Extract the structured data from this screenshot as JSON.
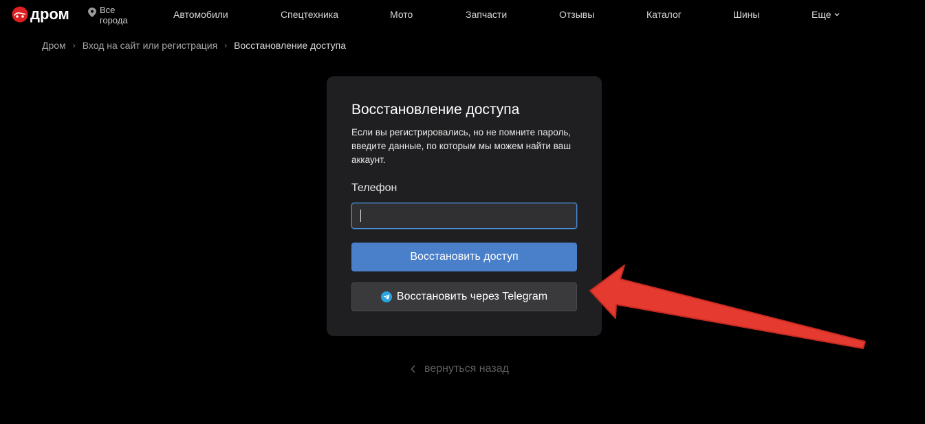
{
  "header": {
    "logo_text": "дром",
    "city": "Все города",
    "nav": [
      {
        "label": "Автомобили"
      },
      {
        "label": "Спецтехника"
      },
      {
        "label": "Мото"
      },
      {
        "label": "Запчасти"
      },
      {
        "label": "Отзывы"
      },
      {
        "label": "Каталог"
      },
      {
        "label": "Шины"
      }
    ],
    "more_label": "Еще"
  },
  "breadcrumb": {
    "items": [
      "Дром",
      "Вход на сайт или регистрация"
    ],
    "current": "Восстановление доступа",
    "separator": "›"
  },
  "card": {
    "title": "Восстановление доступа",
    "description": "Если вы регистрировались, но не помните пароль, введите данные, по которым мы можем найти ваш аккаунт.",
    "phone_label": "Телефон",
    "phone_value": "",
    "primary_button": "Восстановить доступ",
    "telegram_button": "Восстановить через Telegram"
  },
  "back_link": "вернуться назад",
  "colors": {
    "brand_red": "#e02020",
    "primary_blue": "#4a7fca",
    "telegram_blue": "#2aa3e0",
    "annotation_arrow": "#e53a2f"
  },
  "icons": {
    "logo": "drom-logo-icon",
    "city": "location-pin-icon",
    "more": "chevron-down-icon",
    "telegram": "telegram-icon",
    "back": "chevron-left-icon"
  }
}
